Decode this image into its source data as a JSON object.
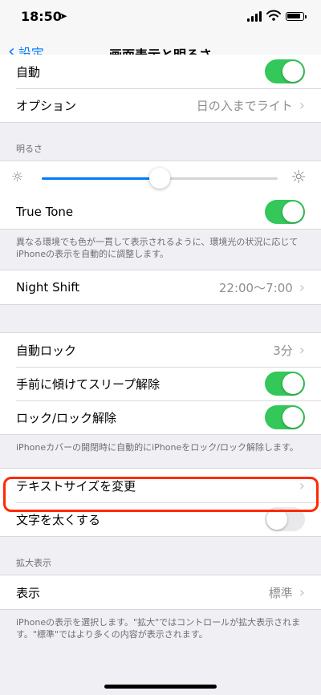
{
  "status": {
    "time": "18:50"
  },
  "nav": {
    "back_label": "設定",
    "title": "画面表示と明るさ"
  },
  "appearance": {
    "auto_label": "自動",
    "auto_on": true,
    "options_label": "オプション",
    "options_value": "日の入までライト"
  },
  "brightness": {
    "header": "明るさ",
    "level": 0.5,
    "truetone_label": "True Tone",
    "truetone_on": true,
    "truetone_footer": "異なる環境でも色が一貫して表示されるように、環境光の状況に応じてiPhoneの表示を自動的に調整します。"
  },
  "night_shift": {
    "label": "Night Shift",
    "value": "22:00〜7:00"
  },
  "lock": {
    "autolock_label": "自動ロック",
    "autolock_value": "3分",
    "raise_label": "手前に傾けてスリープ解除",
    "raise_on": true,
    "lockunlock_label": "ロック/ロック解除",
    "lockunlock_on": true,
    "footer": "iPhoneカバーの開閉時に自動的にiPhoneをロック/ロック解除します。"
  },
  "text": {
    "size_label": "テキストサイズを変更",
    "bold_label": "文字を太くする",
    "bold_on": false
  },
  "zoom": {
    "header": "拡大表示",
    "view_label": "表示",
    "view_value": "標準",
    "footer": "iPhoneの表示を選択します。\"拡大\"ではコントロールが拡大表示されます。\"標準\"ではより多くの内容が表示されます。"
  },
  "colors": {
    "accent": "#007aff",
    "toggle_on": "#34c759",
    "highlight": "#ff2a00"
  }
}
